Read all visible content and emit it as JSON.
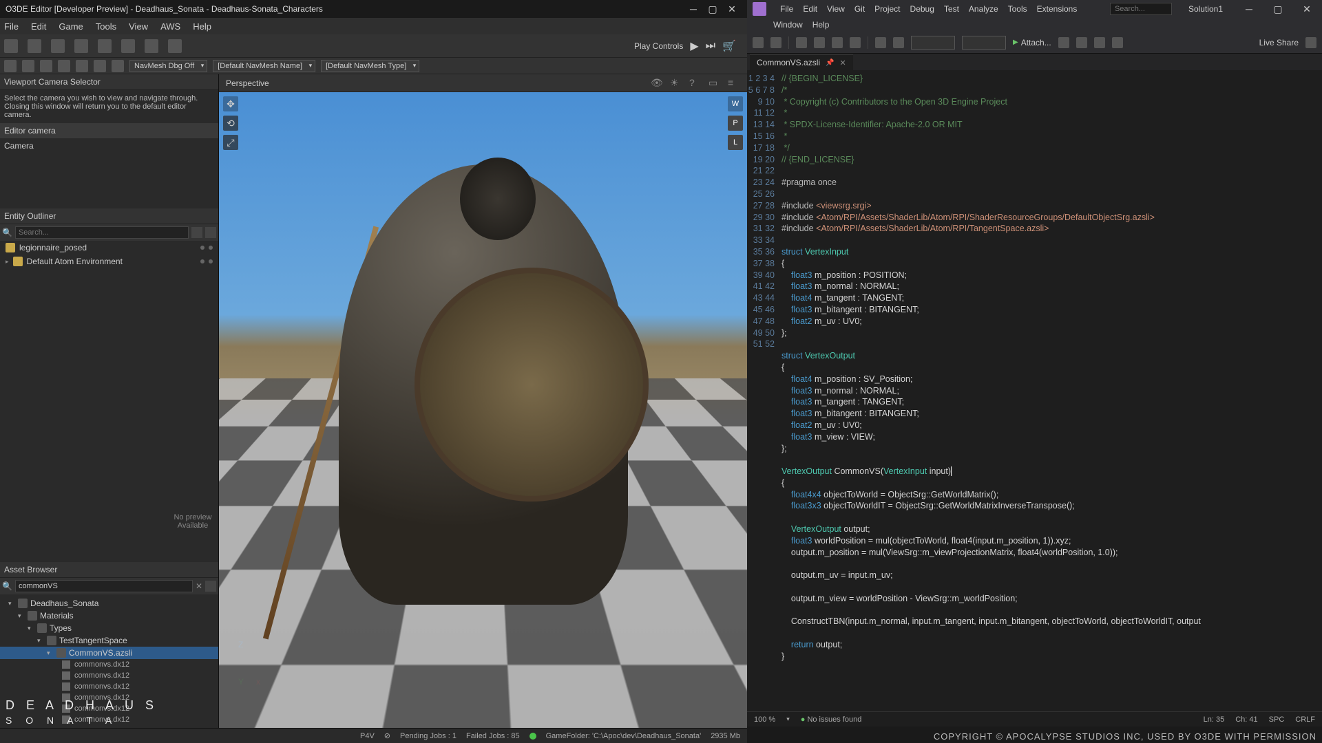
{
  "o3de": {
    "title": "O3DE Editor [Developer Preview] - Deadhaus_Sonata - Deadhaus-Sonata_Characters",
    "menu": [
      "File",
      "Edit",
      "Game",
      "Tools",
      "View",
      "AWS",
      "Help"
    ],
    "navmesh_dd": "NavMesh Dbg Off",
    "default_name": "[Default NavMesh Name]",
    "default_type": "[Default NavMesh Type]",
    "play_label": "Play Controls",
    "camera_panel": {
      "title": "Viewport Camera Selector",
      "hint": "Select the camera you wish to view and navigate through.  Closing this window will return you to the default editor camera.",
      "items": [
        "Editor camera",
        "Camera"
      ]
    },
    "outliner": {
      "title": "Entity Outliner",
      "search_ph": "Search...",
      "items": [
        {
          "label": "legionnaire_posed"
        },
        {
          "label": "Default Atom Environment"
        }
      ]
    },
    "asset": {
      "title": "Asset Browser",
      "search_value": "commonVS",
      "tree": {
        "root": "Deadhaus_Sonata",
        "l1": "Materials",
        "l2": "Types",
        "l3": "TestTangentSpace",
        "sel": "CommonVS.azsli",
        "files": [
          "commonvs.dx12",
          "commonvs.dx12",
          "commonvs.dx12",
          "commonvs.dx12",
          "commonvs.dx12",
          "commonvs.dx12"
        ]
      },
      "preview": "No preview Available"
    },
    "viewport_label": "Perspective",
    "side_btns": [
      "W",
      "P",
      "L"
    ],
    "axis": {
      "z": "Z",
      "y": "Y",
      "x": "x"
    },
    "status": {
      "p4v": "P4V",
      "pending": "Pending Jobs : 1",
      "failed": "Failed Jobs : 85",
      "folder": "GameFolder: 'C:\\Apoc\\dev\\Deadhaus_Sonata'",
      "mem": "2935 Mb"
    },
    "logo_l1": "D E A D H A U S",
    "logo_l2": "S   O   N   A   T   A"
  },
  "vs": {
    "menu": [
      "File",
      "Edit",
      "View",
      "Git",
      "Project",
      "Debug",
      "Test",
      "Analyze",
      "Tools",
      "Extensions",
      "Window",
      "Help"
    ],
    "search_ph": "Search...",
    "solution": "Solution1",
    "attach": "Attach...",
    "live_share": "Live Share",
    "tab": "CommonVS.azsli",
    "lines": [
      1,
      2,
      3,
      4,
      5,
      6,
      7,
      8,
      9,
      10,
      11,
      12,
      13,
      14,
      15,
      16,
      17,
      18,
      19,
      20,
      21,
      22,
      23,
      24,
      25,
      26,
      27,
      28,
      29,
      30,
      31,
      32,
      33,
      34,
      35,
      36,
      37,
      38,
      39,
      40,
      41,
      42,
      43,
      44,
      45,
      46,
      47,
      48,
      49,
      50,
      51,
      52
    ],
    "status": {
      "zoom": "100 %",
      "issues": "No issues found",
      "ln": "Ln: 35",
      "ch": "Ch: 41",
      "spc": "SPC",
      "crlf": "CRLF"
    }
  },
  "copyright": "COPYRIGHT © APOCALYPSE STUDIOS INC, USED BY O3DE WITH PERMISSION"
}
